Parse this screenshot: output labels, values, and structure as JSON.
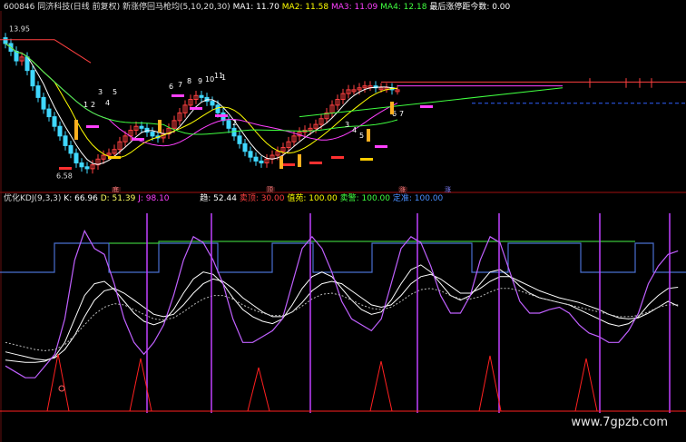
{
  "upper_header": {
    "code": "600846",
    "name": "同济科技(日线 前复权)",
    "indicator": "新涨停回马枪均(5,10,20,30)",
    "ma1_label": "MA1: 11.70",
    "ma2_label": "MA2: 11.58",
    "ma3_label": "MA3: 11.09",
    "ma4_label": "MA4: 12.18",
    "last_limit": "最后涨停距今数: 0.00"
  },
  "lower_header": {
    "indicator": "优化KDJ(9,3,3)",
    "k_label": "K: 66.96",
    "d_label": "D: 51.39",
    "j_label": "J: 98.10",
    "trend_label": "趋: 52.44",
    "t1_label": "卖顶: 30.00",
    "t2_label": "值苑: 100.00",
    "t3_label": "卖警: 100.00",
    "t4_label": "定准: 100.00"
  },
  "price_labels": {
    "high": "13.95",
    "low": "6.58",
    "numbers": [
      "1",
      "2",
      "3",
      "4",
      "5",
      "6",
      "7",
      "8",
      "9",
      "10",
      "11"
    ]
  },
  "markers": [
    "底",
    "顶",
    "涨"
  ],
  "watermark": "www.7gpzb.com",
  "colors": {
    "background": "#000000",
    "up": "#ff4040",
    "down": "#40d8ff",
    "ma1": "#ffffff",
    "ma2": "#ffff00",
    "ma3": "#ff40ff",
    "ma4": "#40ff40",
    "k": "#ffffff",
    "d": "#ffffff",
    "j": "#c060ff",
    "blue_step": "#4a6fd0",
    "green_step": "#3ac03a",
    "spike": "#ff2020",
    "divider": "#a01010"
  },
  "chart_data": [
    {
      "type": "candlestick",
      "title": "600846 同济科技(日线 前复权)",
      "ylim": [
        6,
        15
      ],
      "y_high_label": "13.95",
      "y_low_label": "6.58",
      "close": [
        13.4,
        13.0,
        12.5,
        12.7,
        12.0,
        11.2,
        10.6,
        10.0,
        9.6,
        9.1,
        8.6,
        8.1,
        7.7,
        7.2,
        7.0,
        6.9,
        7.1,
        7.4,
        7.6,
        7.7,
        7.9,
        8.3,
        8.6,
        8.9,
        9.1,
        9.0,
        8.8,
        8.6,
        8.5,
        8.7,
        9.0,
        9.4,
        9.8,
        10.2,
        10.5,
        10.7,
        10.6,
        10.4,
        10.2,
        9.8,
        9.4,
        9.0,
        8.6,
        8.2,
        7.8,
        7.5,
        7.3,
        7.2,
        7.4,
        7.6,
        7.8,
        8.0,
        8.3,
        8.6,
        8.8,
        8.9,
        9.0,
        9.2,
        9.5,
        9.8,
        10.2,
        10.5,
        10.8,
        11.0,
        11.0,
        11.1,
        11.2,
        11.2,
        11.1,
        11.1,
        11.1,
        11.0,
        11.0
      ]
    },
    {
      "type": "line",
      "title": "优化KDJ(9,3,3)",
      "ylim": [
        -40,
        140
      ],
      "series": [
        {
          "name": "K",
          "values": [
            5,
            4,
            3,
            3,
            4,
            8,
            20,
            40,
            60,
            70,
            72,
            65,
            55,
            45,
            38,
            35,
            38,
            48,
            62,
            74,
            80,
            78,
            70,
            58,
            48,
            42,
            38,
            36,
            40,
            52,
            66,
            76,
            80,
            76,
            66,
            56,
            48,
            44,
            46,
            56,
            70,
            82,
            86,
            80,
            70,
            60,
            56,
            60,
            70,
            80,
            82,
            76,
            68,
            62,
            58,
            56,
            54,
            52,
            48,
            44,
            40,
            36,
            34,
            36,
            42,
            52,
            60,
            66,
            67
          ]
        },
        {
          "name": "D",
          "values": [
            12,
            10,
            8,
            6,
            5,
            7,
            14,
            26,
            42,
            56,
            64,
            66,
            62,
            56,
            50,
            44,
            42,
            44,
            52,
            62,
            70,
            74,
            72,
            66,
            58,
            52,
            46,
            42,
            42,
            46,
            54,
            64,
            70,
            72,
            70,
            64,
            58,
            52,
            50,
            52,
            60,
            70,
            76,
            78,
            74,
            68,
            62,
            62,
            66,
            72,
            76,
            76,
            72,
            68,
            64,
            61,
            58,
            56,
            54,
            51,
            48,
            44,
            41,
            40,
            41,
            45,
            50,
            55,
            51
          ]
        },
        {
          "name": "J",
          "values": [
            0,
            -5,
            -10,
            -10,
            0,
            10,
            40,
            90,
            115,
            100,
            95,
            70,
            40,
            20,
            10,
            20,
            35,
            60,
            90,
            110,
            105,
            90,
            70,
            40,
            20,
            20,
            25,
            30,
            40,
            70,
            100,
            110,
            100,
            80,
            55,
            40,
            35,
            30,
            40,
            70,
            100,
            110,
            105,
            85,
            60,
            45,
            45,
            60,
            90,
            110,
            105,
            80,
            55,
            45,
            45,
            48,
            50,
            45,
            35,
            28,
            25,
            20,
            20,
            30,
            45,
            70,
            85,
            95,
            98
          ]
        },
        {
          "name": "趋",
          "values": [
            20,
            18,
            16,
            14,
            13,
            14,
            18,
            26,
            35,
            44,
            50,
            53,
            52,
            48,
            44,
            40,
            39,
            41,
            46,
            52,
            57,
            60,
            60,
            57,
            52,
            48,
            45,
            43,
            43,
            46,
            51,
            57,
            61,
            62,
            60,
            56,
            52,
            49,
            48,
            50,
            55,
            61,
            65,
            66,
            64,
            60,
            57,
            57,
            59,
            63,
            66,
            66,
            64,
            61,
            58,
            56,
            54,
            52,
            50,
            48,
            46,
            44,
            42,
            42,
            43,
            46,
            50,
            52,
            52
          ]
        }
      ]
    }
  ]
}
